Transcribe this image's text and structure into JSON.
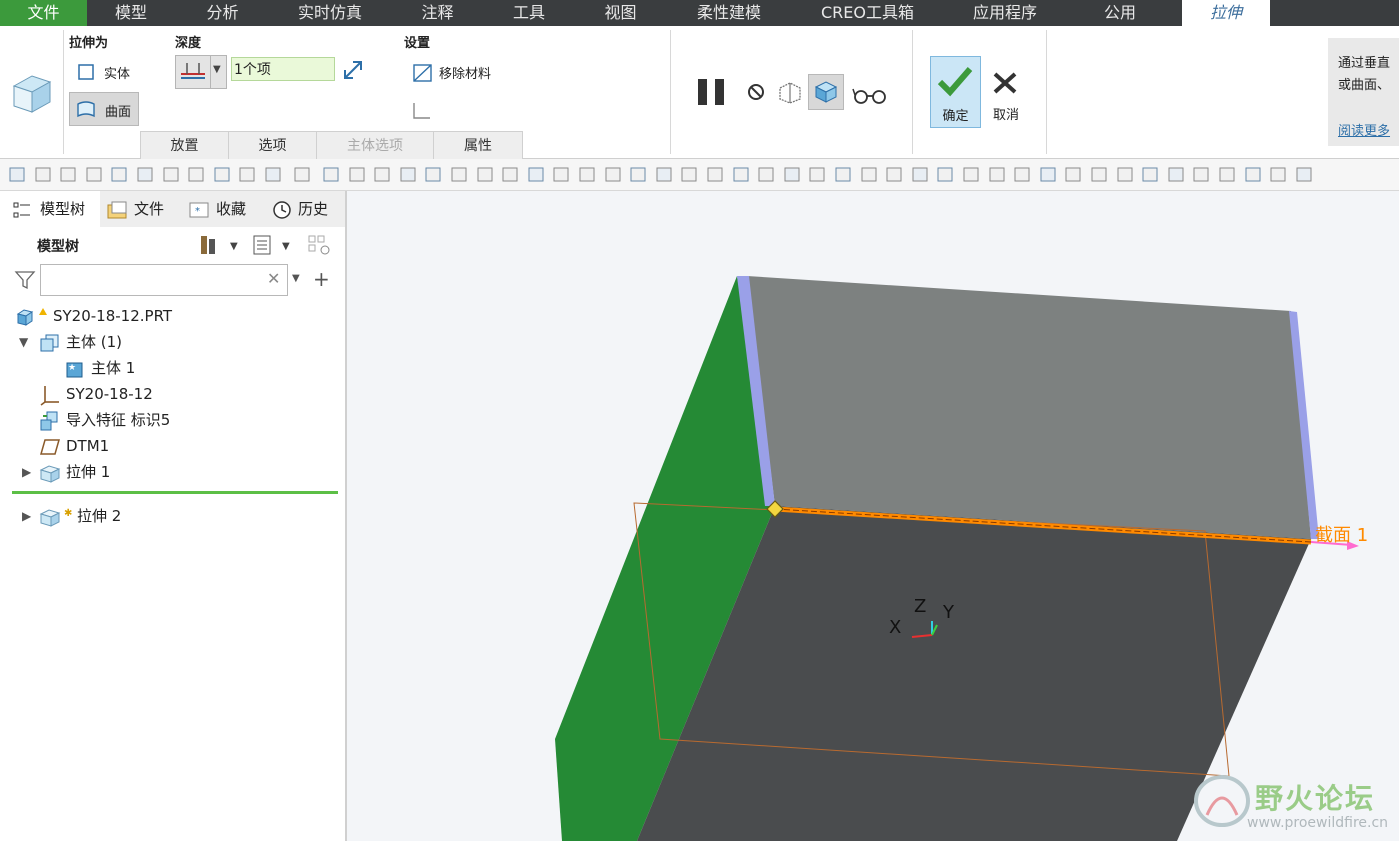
{
  "menubar": {
    "items": [
      {
        "label": "文件"
      },
      {
        "label": "模型"
      },
      {
        "label": "分析"
      },
      {
        "label": "实时仿真"
      },
      {
        "label": "注释"
      },
      {
        "label": "工具"
      },
      {
        "label": "视图"
      },
      {
        "label": "柔性建模"
      },
      {
        "label": "CREO工具箱"
      },
      {
        "label": "应用程序"
      },
      {
        "label": "公用"
      },
      {
        "label": "拉伸"
      }
    ]
  },
  "ribbon": {
    "extrude_as_label": "拉伸为",
    "solid_label": "实体",
    "surface_label": "曲面",
    "depth_label": "深度",
    "depth_value": "1个项",
    "settings_label": "设置",
    "remove_material_label": "移除材料",
    "confirm_label": "确定",
    "cancel_label": "取消",
    "tabs": [
      {
        "label": "放置"
      },
      {
        "label": "选项"
      },
      {
        "label": "主体选项"
      },
      {
        "label": "属性"
      }
    ],
    "help_line1": "通过垂直",
    "help_line2": "或曲面、",
    "help_link": "阅读更多"
  },
  "left_panel": {
    "tabs": [
      {
        "label": "模型树"
      },
      {
        "label": "文件"
      },
      {
        "label": "收藏"
      },
      {
        "label": "历史"
      }
    ],
    "tree_title": "模型树",
    "search_placeholder": "",
    "tree": [
      {
        "label": "SY20-18-12.PRT"
      },
      {
        "label": "主体 (1)"
      },
      {
        "label": "主体 1"
      },
      {
        "label": "SY20-18-12"
      },
      {
        "label": "导入特征 标识5"
      },
      {
        "label": "DTM1"
      },
      {
        "label": "拉伸 1"
      },
      {
        "label": "拉伸 2"
      }
    ]
  },
  "viewport": {
    "section_label": "截面 1",
    "axis_x": "X",
    "axis_y": "Y",
    "axis_z": "Z",
    "watermark_title": "野火论坛",
    "watermark_url": "www.proewildfire.cn"
  },
  "colors": {
    "menubar_bg": "#3a3d3f",
    "file_tab": "#3c9a3c",
    "active_tab_text": "#3c6e9c",
    "green_face": "#258a35",
    "top_face": "#7d8180",
    "front_face": "#4a4c4e",
    "edge_highlight": "#ff8a00"
  }
}
